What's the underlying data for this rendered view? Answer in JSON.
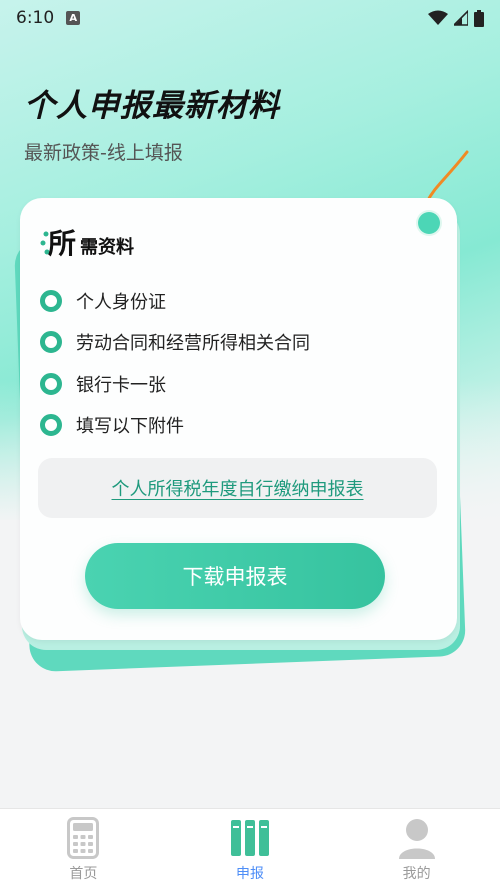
{
  "status_bar": {
    "time": "6:10",
    "notification_badge": "A",
    "icons": [
      "wifi-icon",
      "signal-icon",
      "battery-icon"
    ]
  },
  "header": {
    "title": "个人申报最新材料",
    "subtitle": "最新政策-线上填报"
  },
  "card": {
    "logo_char": "所",
    "header_text": "需资料",
    "requirements": [
      "个人身份证",
      "劳动合同和经营所得相关合同",
      "银行卡一张",
      "填写以下附件"
    ],
    "form_link": "个人所得税年度自行缴纳申报表",
    "download_button": "下载申报表"
  },
  "tabs": [
    {
      "label": "首页",
      "icon": "calculator-icon",
      "active": false
    },
    {
      "label": "申报",
      "icon": "books-icon",
      "active": true
    },
    {
      "label": "我的",
      "icon": "user-icon",
      "active": false
    }
  ],
  "colors": {
    "accent": "#36c39f",
    "accent_dark": "#2db690",
    "link": "#1f9a7d",
    "tab_active": "#4e8ef7",
    "tab_inactive": "#9a9a9a",
    "string_orange": "#f08a24"
  }
}
